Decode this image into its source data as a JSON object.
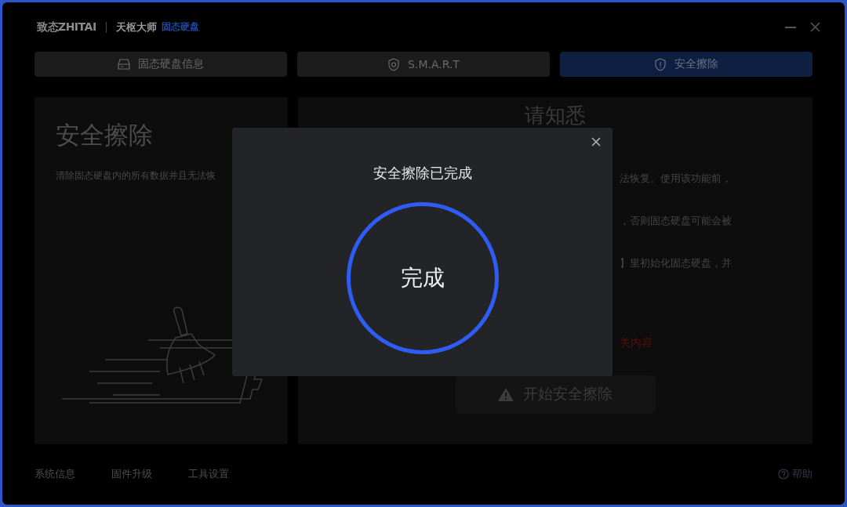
{
  "brand": {
    "logo": "致态ZHITAI",
    "product": "天枢大师",
    "product_tag": "固态硬盘"
  },
  "tabs": [
    {
      "label": "固态硬盘信息",
      "selected": false
    },
    {
      "label": "S.M.A.R.T",
      "selected": false
    },
    {
      "label": "安全擦除",
      "selected": true
    }
  ],
  "left_panel": {
    "title": "安全擦除",
    "description": "清除固态硬盘内的所有数据并且无法恢"
  },
  "notice_panel": {
    "title": "请知悉",
    "lines": [
      "法恢复。使用该功能前，",
      "，否则固态硬盘可能会被",
      "】里初始化固态硬盘，并"
    ],
    "warning": "关内容",
    "button": "开始安全擦除"
  },
  "dialog": {
    "title": "安全擦除已完成",
    "status": "完成"
  },
  "footer": {
    "links": [
      "系统信息",
      "固件升级",
      "工具设置"
    ],
    "help": "帮助"
  }
}
